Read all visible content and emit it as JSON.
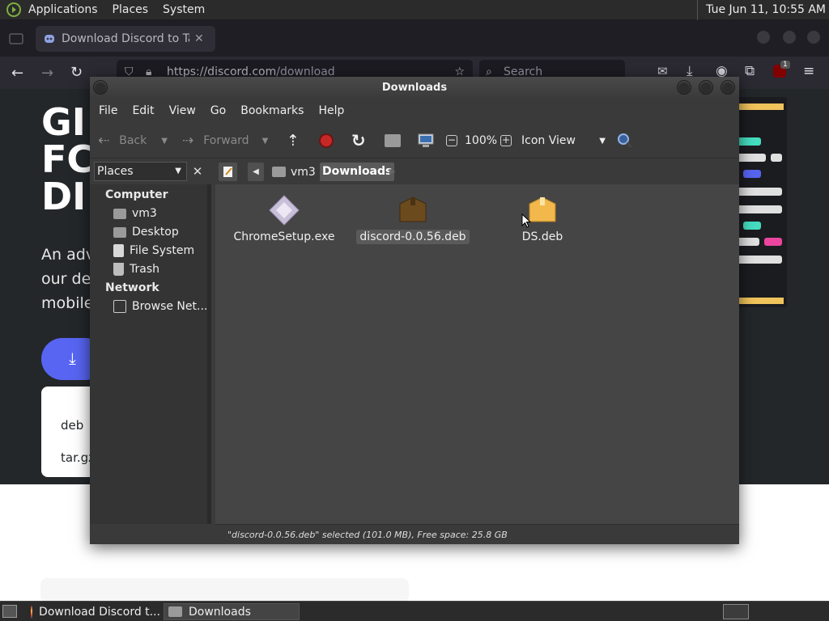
{
  "top_panel": {
    "menus": [
      "Applications",
      "Places",
      "System"
    ],
    "clock": "Tue Jun 11, 10:55 AM"
  },
  "browser": {
    "tab_title": "Download Discord to Talk",
    "url_host": "https://discord.com",
    "url_path": "/download",
    "search_placeholder": "Search",
    "badge_count": "1",
    "hero_title_lines": [
      "GI",
      "FC",
      "DI"
    ],
    "hero_text_lines": [
      "An adv",
      "our des",
      "mobile."
    ],
    "download_options": [
      "deb",
      "tar.gz"
    ]
  },
  "file_manager": {
    "title": "Downloads",
    "menus": [
      "File",
      "Edit",
      "View",
      "Go",
      "Bookmarks",
      "Help"
    ],
    "toolbar": {
      "back_label": "Back",
      "forward_label": "Forward",
      "zoom": "100%",
      "view_mode": "Icon View"
    },
    "sidebar_combo": "Places",
    "path": [
      "vm3",
      "Downloads"
    ],
    "sidebar": {
      "computer_heading": "Computer",
      "computer_items": [
        "vm3",
        "Desktop",
        "File System",
        "Trash"
      ],
      "network_heading": "Network",
      "network_items": [
        "Browse Net..."
      ]
    },
    "files": [
      {
        "name": "ChromeSetup.exe",
        "icon": "executable-icon",
        "selected": false
      },
      {
        "name": "discord-0.0.56.deb",
        "icon": "package-icon",
        "selected": true
      },
      {
        "name": "DS.deb",
        "icon": "package-icon",
        "selected": false
      }
    ],
    "status": "\"discord-0.0.56.deb\" selected (101.0 MB), Free space: 25.8 GB"
  },
  "taskbar": {
    "tasks": [
      "Download Discord t...",
      "Downloads"
    ]
  },
  "colors": {
    "accent_blurple": "#5865f2",
    "panel_bg": "#2b2b2b",
    "window_bg": "#3b3b3b"
  }
}
